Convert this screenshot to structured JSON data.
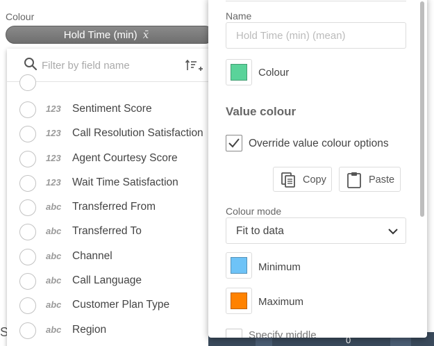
{
  "background": {
    "colour_label": "Colour",
    "pill": {
      "label": "Hold Time (min)",
      "agg_symbol": "x̄"
    },
    "ghost_letter": "S"
  },
  "field_dropdown": {
    "filter_placeholder": "Filter by field name",
    "fields": [
      {
        "type": "123",
        "name": "Sentiment Score"
      },
      {
        "type": "123",
        "name": "Call Resolution Satisfaction"
      },
      {
        "type": "123",
        "name": "Agent Courtesy Score"
      },
      {
        "type": "123",
        "name": "Wait Time Satisfaction"
      },
      {
        "type": "abc",
        "name": "Transferred From"
      },
      {
        "type": "abc",
        "name": "Transferred To"
      },
      {
        "type": "abc",
        "name": "Channel"
      },
      {
        "type": "abc",
        "name": "Call Language"
      },
      {
        "type": "abc",
        "name": "Customer Plan Type"
      },
      {
        "type": "abc",
        "name": "Region"
      }
    ]
  },
  "properties": {
    "name_label": "Name",
    "name_placeholder": "Hold Time (min) (mean)",
    "colour": {
      "label": "Colour",
      "color": "#5ad39a"
    },
    "value_colour_title": "Value colour",
    "override_label": "Override value colour options",
    "override_checked": true,
    "copy_label": "Copy",
    "paste_label": "Paste",
    "colour_mode_label": "Colour mode",
    "colour_mode_value": "Fit to data",
    "minimum": {
      "label": "Minimum",
      "color": "#6ec3f7"
    },
    "maximum": {
      "label": "Maximum",
      "color": "#ff8200"
    },
    "specify_middle_label": "Specify middle"
  },
  "bottom_strip": {
    "value": "0"
  }
}
